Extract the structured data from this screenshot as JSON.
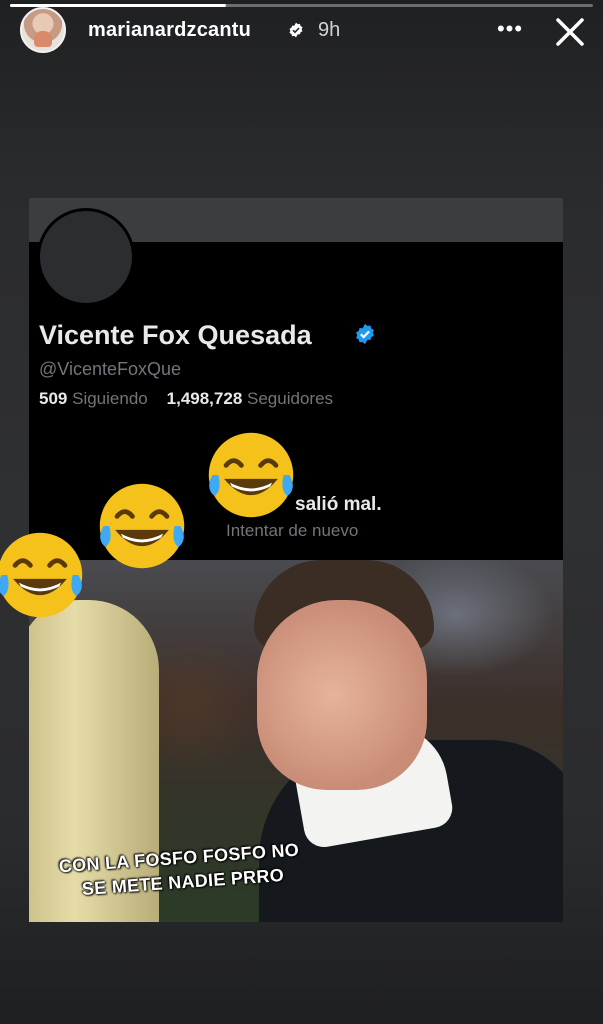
{
  "story": {
    "username": "marianardzcantu",
    "time": "9h",
    "more_icon": "ellipsis-icon",
    "close_icon": "close-icon",
    "progress": 0.37
  },
  "tweet_profile": {
    "name": "Vicente Fox Quesada",
    "handle": "@VicenteFoxQue",
    "following_count": "509",
    "following_label": "Siguiendo",
    "followers_count": "1,498,728",
    "followers_label": "Seguidores",
    "error_text": "salió mal.",
    "retry_text": "Intentar de nuevo"
  },
  "meme": {
    "caption_line1": "CON LA FOSFO FOSFO NO",
    "caption_line2": "SE METE NADIE PRRO"
  },
  "colors": {
    "verified": "#1d9bf0",
    "card_bg": "#000000",
    "muted_text": "#71767b"
  },
  "stickers": [
    "laughing-emoji",
    "laughing-emoji",
    "laughing-emoji"
  ]
}
